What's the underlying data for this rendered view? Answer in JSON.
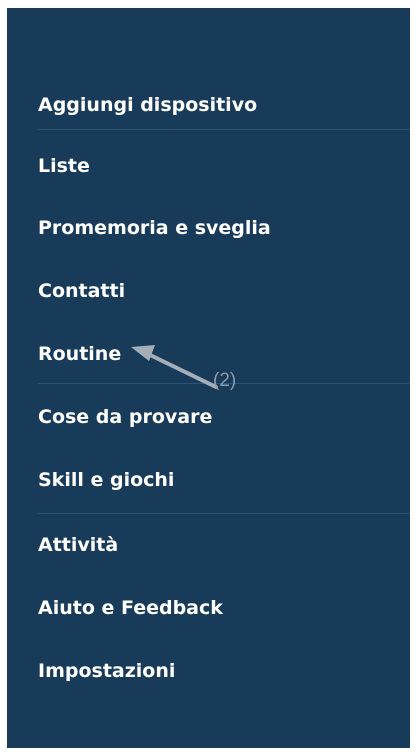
{
  "menu": {
    "items": [
      {
        "label": "Aggiungi dispositivo"
      },
      {
        "label": "Liste"
      },
      {
        "label": "Promemoria e sveglia"
      },
      {
        "label": "Contatti"
      },
      {
        "label": "Routine"
      },
      {
        "label": "Cose da provare"
      },
      {
        "label": "Skill e giochi"
      },
      {
        "label": "Attività"
      },
      {
        "label": "Aiuto e Feedback"
      },
      {
        "label": "Impostazioni"
      }
    ]
  },
  "annotation": {
    "label": "(2)"
  },
  "colors": {
    "drawer_background": "#183b5a",
    "text": "#ffffff",
    "divider": "#2e5274",
    "annotation": "#8a9cad"
  }
}
